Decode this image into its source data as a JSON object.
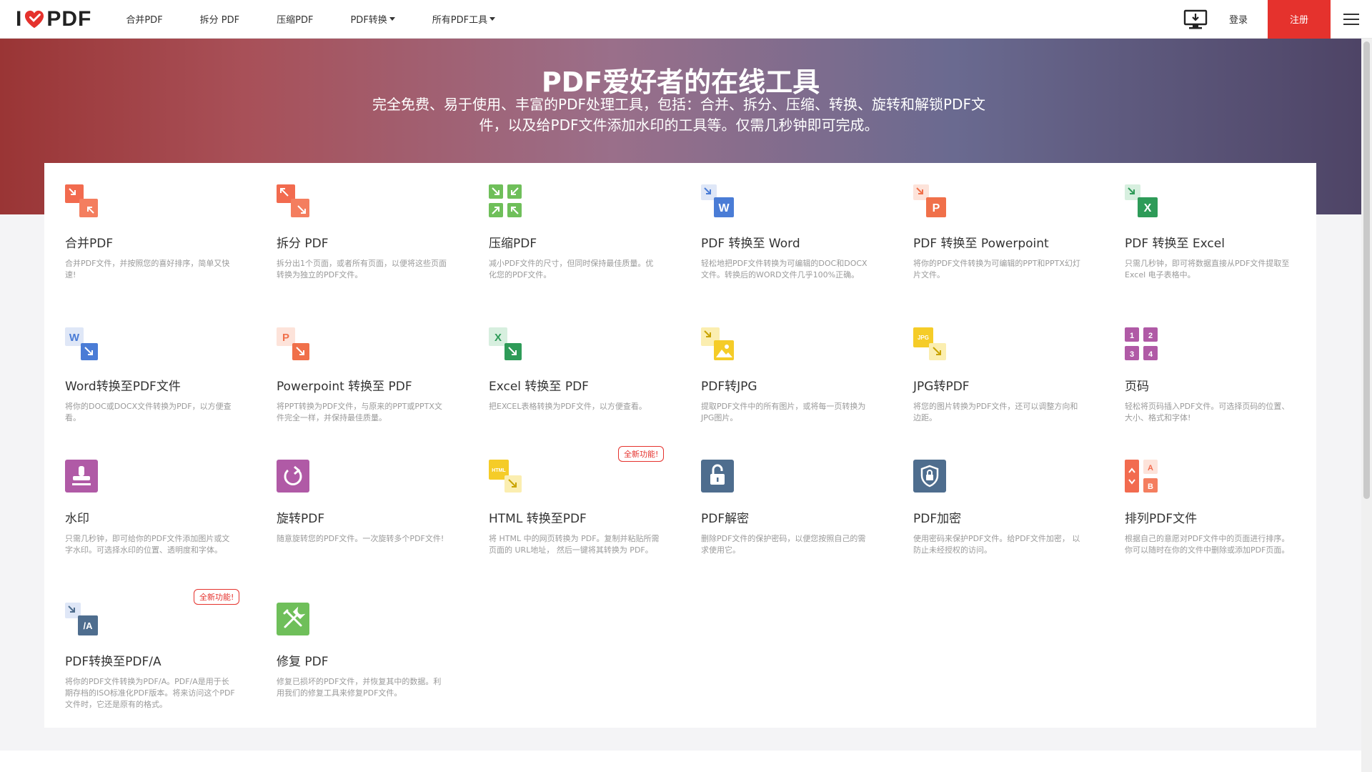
{
  "nav": {
    "logo_left": "I",
    "logo_right": "PDF",
    "items": [
      {
        "label": "合并PDF",
        "dropdown": false
      },
      {
        "label": "拆分 PDF",
        "dropdown": false
      },
      {
        "label": "压缩PDF",
        "dropdown": false
      },
      {
        "label": "PDF转换",
        "dropdown": true
      },
      {
        "label": "所有PDF工具",
        "dropdown": true
      }
    ],
    "login": "登录",
    "signup": "注册"
  },
  "hero": {
    "title": "PDF爱好者的在线工具",
    "subtitle": "完全免费、易于使用、丰富的PDF处理工具，包括：合并、拆分、压缩、转换、旋转和解锁PDF文件，以及给PDF文件添加水印的工具等。仅需几秒钟即可完成。"
  },
  "badges": {
    "new": "全新功能!"
  },
  "tools": [
    {
      "title": "合并PDF",
      "desc": "合并PDF文件，并按照您的喜好排序，简单又快速!",
      "icon": "merge-icon"
    },
    {
      "title": "拆分 PDF",
      "desc": "拆分出1个页面，或者所有页面，以便将这些页面转换为独立的PDF文件。",
      "icon": "split-icon"
    },
    {
      "title": "压缩PDF",
      "desc": "减小PDF文件的尺寸，但同时保持最佳质量。优化您的PDF文件。",
      "icon": "compress-icon"
    },
    {
      "title": "PDF 转换至 Word",
      "desc": "轻松地把PDF文件转换为可编辑的DOC和DOCX文件。转换后的WORD文件几乎100%正确。",
      "icon": "pdf-to-word-icon"
    },
    {
      "title": "PDF 转换至 Powerpoint",
      "desc": "将你的PDF文件转换为可编辑的PPT和PPTX幻灯片文件。",
      "icon": "pdf-to-powerpoint-icon"
    },
    {
      "title": "PDF 转换至 Excel",
      "desc": "只需几秒钟，即可将数据直接从PDF文件提取至Excel 电子表格中。",
      "icon": "pdf-to-excel-icon"
    },
    {
      "title": "Word转换至PDF文件",
      "desc": "将你的DOC或DOCX文件转换为PDF，以方便查看。",
      "icon": "word-to-pdf-icon"
    },
    {
      "title": "Powerpoint 转换至 PDF",
      "desc": "将PPT转换为PDF文件，与原来的PPT或PPTX文件完全一样，并保持最佳质量。",
      "icon": "powerpoint-to-pdf-icon"
    },
    {
      "title": "Excel 转换至 PDF",
      "desc": "把EXCEL表格转换为PDF文件，以方便查看。",
      "icon": "excel-to-pdf-icon"
    },
    {
      "title": "PDF转JPG",
      "desc": "提取PDF文件中的所有图片，或将每一页转换为JPG图片。",
      "icon": "pdf-to-jpg-icon"
    },
    {
      "title": "JPG转PDF",
      "desc": "将您的图片转换为PDF文件，还可以调整方向和边距。",
      "icon": "jpg-to-pdf-icon"
    },
    {
      "title": "页码",
      "desc": "轻松将页码插入PDF文件。可选择页码的位置、大小、格式和字体!",
      "icon": "page-numbers-icon"
    },
    {
      "title": "水印",
      "desc": "只需几秒钟，即可给你的PDF文件添加图片或文字水印。可选择水印的位置、透明度和字体。",
      "icon": "watermark-icon"
    },
    {
      "title": "旋转PDF",
      "desc": "随意旋转您的PDF文件。一次旋转多个PDF文件!",
      "icon": "rotate-icon"
    },
    {
      "title": "HTML 转换至PDF",
      "desc": "将 HTML 中的网页转换为 PDF。复制并粘贴所需页面的 URL地址， 然后一键将其转换为 PDF。",
      "icon": "html-to-pdf-icon",
      "badge": true
    },
    {
      "title": "PDF解密",
      "desc": "删除PDF文件的保护密码，以便您按照自己的需求使用它。",
      "icon": "unlock-icon"
    },
    {
      "title": "PDF加密",
      "desc": "使用密码来保护PDF文件。给PDF文件加密， 以防止未经授权的访问。",
      "icon": "protect-icon"
    },
    {
      "title": "排列PDF文件",
      "desc": "根据自己的意愿对PDF文件中的页面进行排序。你可以随时在你的文件中删除或添加PDF页面。",
      "icon": "organize-icon"
    },
    {
      "title": "PDF转换至PDF/A",
      "desc": "将你的PDF文件转换为PDF/A。PDF/A是用于长期存档的ISO标准化PDF版本。将来访问这个PDF文件时，它还是原有的格式。",
      "icon": "pdf-to-pdfa-icon",
      "badge": true
    },
    {
      "title": "修复 PDF",
      "desc": "修复已损坏的PDF文件，并恢复其中的数据。利用我们的修复工具来修复PDF文件。",
      "icon": "repair-icon"
    }
  ],
  "icon_text": {
    "word": "W",
    "powerpoint": "P",
    "excel": "X",
    "jpg": "JPG",
    "html": "HTML",
    "pdfa": "/A",
    "num1": "1",
    "num2": "2",
    "num3": "3",
    "num4": "4",
    "letterA": "A",
    "letterB": "B"
  },
  "colors": {
    "brand_red": "#e5322d",
    "word_blue": "#4a7cd6",
    "excel_green": "#2e9b58",
    "ppt_orange": "#f0704a",
    "jpg_yellow": "#f5cc28",
    "purple": "#b05aa6",
    "slate": "#4e6d8e"
  }
}
